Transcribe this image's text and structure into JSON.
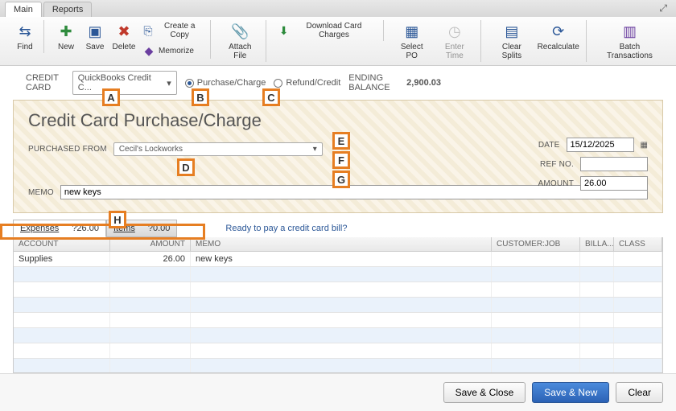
{
  "tabs": {
    "main": "Main",
    "reports": "Reports"
  },
  "toolbar": {
    "find": "Find",
    "new": "New",
    "save": "Save",
    "delete": "Delete",
    "createcopy": "Create a Copy",
    "memorize": "Memorize",
    "attach": "Attach File",
    "download": "Download Card Charges",
    "selectpo": "Select PO",
    "entertime": "Enter Time",
    "clearsplits": "Clear Splits",
    "recalc": "Recalculate",
    "batch": "Batch Transactions"
  },
  "optrow": {
    "creditcard_label": "CREDIT CARD",
    "account": "QuickBooks Credit C...",
    "purchase": "Purchase/Charge",
    "refund": "Refund/Credit",
    "ending_label": "ENDING BALANCE",
    "ending_value": "2,900.03"
  },
  "check": {
    "title": "Credit Card Purchase/Charge",
    "purchased_from_label": "PURCHASED FROM",
    "purchased_from": "Cecil's Lockworks",
    "date_label": "DATE",
    "date": "15/12/2025",
    "refno_label": "REF NO.",
    "refno": "",
    "amount_label": "AMOUNT",
    "amount": "26.00",
    "memo_label": "MEMO",
    "memo": "new keys"
  },
  "subtabs": {
    "expenses_label": "Expenses",
    "expenses_amount": "?26.00",
    "items_label": "Items",
    "items_amount": "?0.00",
    "readylink": "Ready to pay a credit card bill?"
  },
  "grid": {
    "headers": {
      "account": "ACCOUNT",
      "amount": "AMOUNT",
      "memo": "MEMO",
      "customer": "CUSTOMER:JOB",
      "billable": "BILLA...",
      "class": "CLASS"
    },
    "rows": [
      {
        "account": "Supplies",
        "amount": "26.00",
        "memo": "new keys",
        "customer": "",
        "billable": "",
        "class": ""
      }
    ]
  },
  "footer": {
    "saveclose": "Save & Close",
    "savenew": "Save & New",
    "clear": "Clear"
  },
  "callouts": {
    "a": "A",
    "b": "B",
    "c": "C",
    "d": "D",
    "e": "E",
    "f": "F",
    "g": "G",
    "h": "H"
  }
}
